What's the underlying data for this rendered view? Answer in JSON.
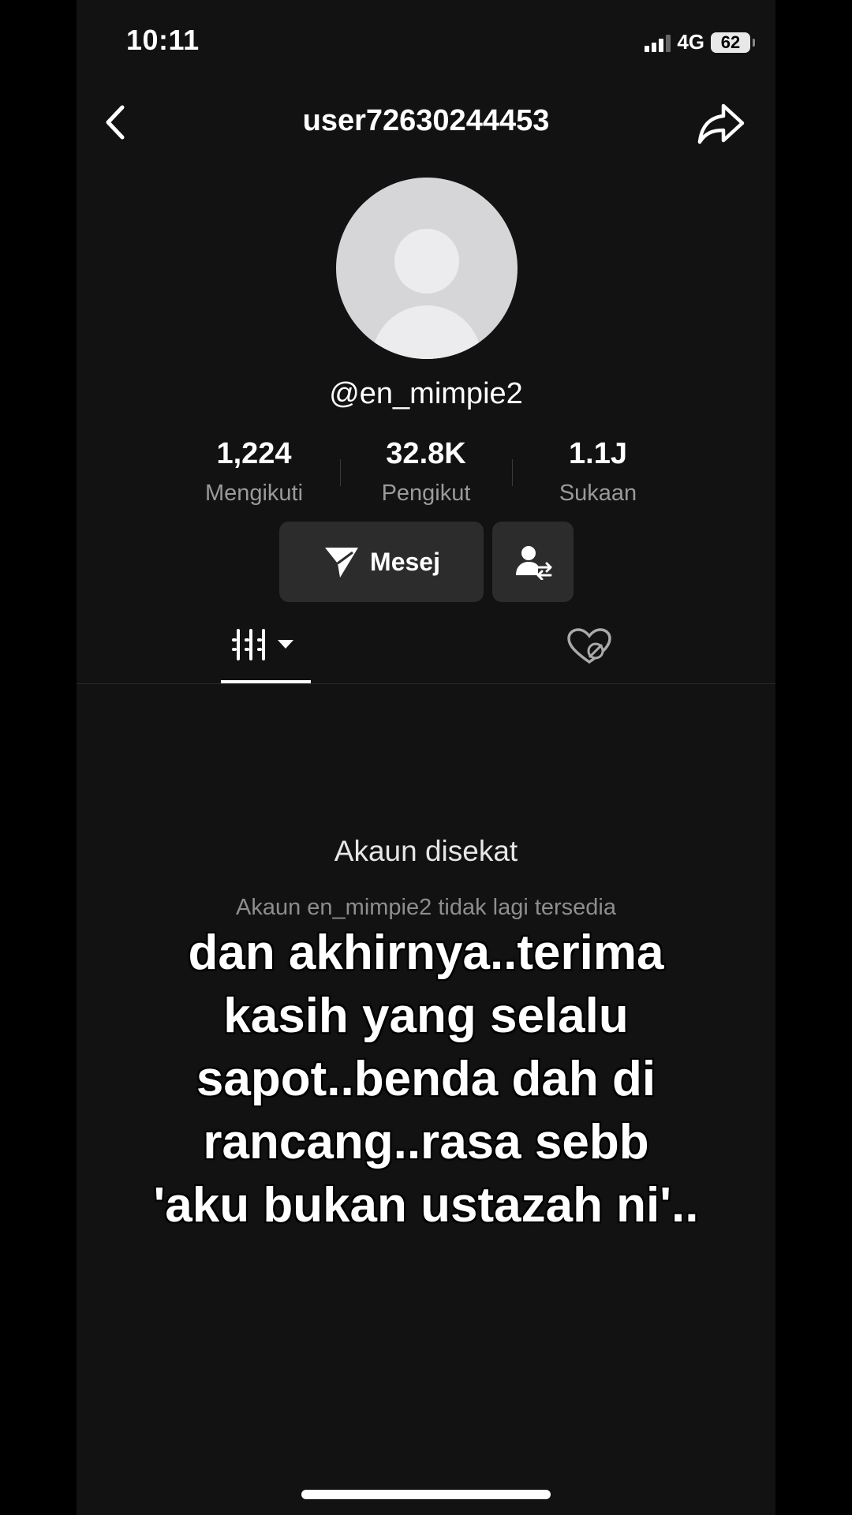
{
  "status_bar": {
    "time": "10:11",
    "network": "4G",
    "battery": "62"
  },
  "header": {
    "title": "user72630244453"
  },
  "profile": {
    "username": "@en_mimpie2",
    "stats": [
      {
        "value": "1,224",
        "label": "Mengikuti"
      },
      {
        "value": "32.8K",
        "label": "Pengikut"
      },
      {
        "value": "1.1J",
        "label": "Sukaan"
      }
    ],
    "message_button": "Mesej"
  },
  "tabs": {
    "active": "videos-tab",
    "icons": [
      "grid-icon",
      "hidden-liked-icon"
    ]
  },
  "content": {
    "blocked_title": "Akaun disekat",
    "blocked_desc": "Akaun en_mimpie2 tidak lagi tersedia"
  },
  "caption": {
    "lines": [
      "dan akhirnya..terima",
      "kasih yang selalu",
      "sapot..benda dah di",
      "rancang..rasa sebb",
      "'aku bukan ustazah ni'.."
    ]
  },
  "colors": {
    "background": "#121212",
    "button": "#2c2c2c",
    "muted_text": "#9a9a9a"
  }
}
